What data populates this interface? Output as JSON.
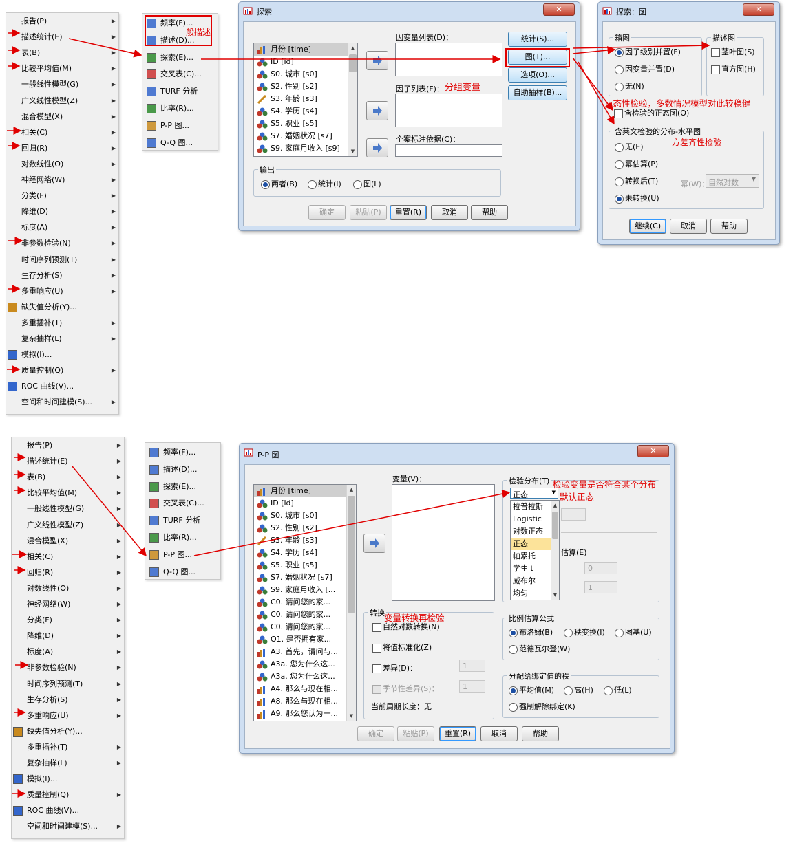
{
  "menu_items": [
    "报告(P)",
    "描述统计(E)",
    "表(B)",
    "比较平均值(M)",
    "一般线性模型(G)",
    "广义线性模型(Z)",
    "混合模型(X)",
    "相关(C)",
    "回归(R)",
    "对数线性(O)",
    "神经网络(W)",
    "分类(F)",
    "降维(D)",
    "标度(A)",
    "非参数检验(N)",
    "时间序列预测(T)",
    "生存分析(S)",
    "多重响应(U)",
    "缺失值分析(Y)...",
    "多重插补(T)",
    "复杂抽样(L)",
    "模拟(I)...",
    "质量控制(Q)",
    "ROC 曲线(V)...",
    "空间和时间建模(S)..."
  ],
  "submenu_items": [
    "频率(F)...",
    "描述(D)...",
    "探索(E)...",
    "交叉表(C)...",
    "TURF 分析",
    "比率(R)...",
    "P-P 图...",
    "Q-Q 图..."
  ],
  "explore": {
    "title": "探索",
    "vars": [
      "月份 [time]",
      "ID [id]",
      "S0. 城市 [s0]",
      "S2. 性别 [s2]",
      "S3. 年龄 [s3]",
      "S4. 学历 [s4]",
      "S5. 职业 [s5]",
      "S7. 婚姻状况 [s7]",
      "S9. 家庭月收入 [s9]"
    ],
    "dep_label": "因变量列表(D)：",
    "factor_label": "因子列表(F)：",
    "case_label": "个案标注依据(C)：",
    "side_buttons": [
      "统计(S)...",
      "图(T)...",
      "选项(O)...",
      "自助抽样(B)..."
    ],
    "output_title": "输出",
    "output_opts": [
      "两者(B)",
      "统计(I)",
      "图(L)"
    ],
    "bottom_buttons": [
      "确定",
      "粘贴(P)",
      "重置(R)",
      "取消",
      "帮助"
    ]
  },
  "plots": {
    "title": "探索：图",
    "box_title": "箱图",
    "box_opts": [
      "因子级别并置(F)",
      "因变量并置(D)",
      "无(N)"
    ],
    "desc_title": "描述图",
    "desc_opts": [
      "茎叶图(S)",
      "直方图(H)"
    ],
    "normal_label": "含检验的正态图(O)",
    "levene_title": "含莱文检验的分布-水平图",
    "levene_opts": [
      "无(E)",
      "幂估算(P)",
      "转换后(T)",
      "未转换(U)"
    ],
    "power_label": "幂(W)：",
    "power_value": "自然对数",
    "buttons": [
      "继续(C)",
      "取消",
      "帮助"
    ]
  },
  "pp": {
    "title": "P-P 图",
    "vars": [
      "月份 [time]",
      "ID [id]",
      "S0. 城市 [s0]",
      "S2. 性别 [s2]",
      "S3. 年龄 [s3]",
      "S4. 学历 [s4]",
      "S5. 职业 [s5]",
      "S7. 婚姻状况 [s7]",
      "S9. 家庭月收入 [...",
      "C0. 请问您的家...",
      "C0. 请问您的家...",
      "C0. 请问您的家...",
      "O1. 是否拥有家...",
      "A3. 首先，请问与...",
      "A3a. 您为什么这...",
      "A3a. 您为什么这...",
      "A4. 那么与现在相...",
      "A8. 那么与现在相...",
      "A9. 那么您认为一..."
    ],
    "var_label": "变量(V)：",
    "dist_title": "检验分布(T)",
    "dist_value": "正态",
    "dist_options": [
      "拉普拉斯",
      "Logistic",
      "对数正态",
      "正态",
      "帕累托",
      "学生 t",
      "威布尔",
      "均匀"
    ],
    "est_label": "估算(E)",
    "field_vals": [
      "0",
      "1"
    ],
    "trans_title": "转换",
    "trans_opts": [
      "自然对数转换(N)",
      "将值标准化(Z)",
      "差异(D)：",
      "季节性差异(S)："
    ],
    "trans_vals": [
      "1",
      "1"
    ],
    "period": "当前周期长度：无",
    "prop_title": "比例估算公式",
    "prop_opts": [
      "布洛姆(B)",
      "秩变换(I)",
      "图基(U)",
      "范德瓦尔登(W)"
    ],
    "tie_title": "分配给绑定值的秩",
    "tie_opts": [
      "平均值(M)",
      "高(H)",
      "低(L)",
      "强制解除绑定(K)"
    ],
    "buttons": [
      "确定",
      "粘贴(P)",
      "重置(R)",
      "取消",
      "帮助"
    ]
  },
  "annotations": {
    "general_desc": "一般描述",
    "group_var": "分组变量",
    "normality": "正态性检验，多数情况模型对此较稳健",
    "homogeneity": "方差齐性检验",
    "dist_check": "检验变量是否符合某个分布",
    "default_normal": "默认正态",
    "transform": "变量转换再检验"
  },
  "colors": {
    "annotation": "#e00000",
    "title_bar": "#cfdff2",
    "dialog": "#f0f0f0"
  }
}
